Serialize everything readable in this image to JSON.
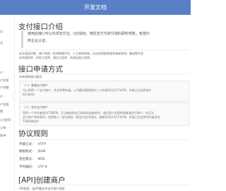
{
  "header": {
    "title": "开发文档"
  },
  "sidebar": {
    "items": [
      {
        "label": "口"
      },
      {
        "label": "式"
      },
      {
        "label": "户"
      },
      {
        "label": "户信息"
      },
      {
        "label": "户余额"
      },
      {
        "label": "户"
      },
      {
        "label": "户信息"
      },
      {
        "label": "费"
      },
      {
        "label": "(小程序)"
      },
      {
        "label": "订单"
      },
      {
        "label": "款单"
      }
    ]
  },
  "main": {
    "section_title": "支付接口介绍",
    "intro_lines": [
      "使用此接口可以实现支付宝、QQ钱包、微信支付与财付通的即时到账，免签约",
      "商企业认证。"
    ],
    "para1": "本文阅读对象：商户系统（在线购物平台、人工收银系统、自动化智能收银系统或其他）集成细节及",
    "para2": "技术架构师、研发工程师、测试工程师、系统运维工程师。",
    "apply_title": "接口申请方式",
    "apply_sub": "共有两种接口模式：",
    "card1": {
      "title": "（一）普通支付商户",
      "line1": "可以获得一个支付商户，完全免费申请。公司随时随地联系人工申请QQ10373458，申请之后会将商户",
      "line2": "KEY给你！"
    },
    "card2": {
      "title": "（二）合作支付商户",
      "line1": "获得一个合作者身份TOKEN，可以集成到自己的网站或者软件，通过接口无限申请普通支付商户，并且当",
      "line2": "支付商户有收款时，所得收入一部分佣金（佣金为合作身份，请联系QQ10373458，申请之后会将合作者身份",
      "line3": "TOKEN给你！"
    },
    "protocol_title": "协议规则",
    "protocol_rows": [
      {
        "key": "传输方式：",
        "value": "HTTP"
      },
      {
        "key": "数据格式：",
        "value": "JSON"
      },
      {
        "key": "签名算法：",
        "value": "MD5"
      },
      {
        "key": "字符编码：",
        "value": "UTF-8"
      }
    ],
    "api_title": "[API]创建商户",
    "api_note": "API权限：该API能合作支付商户调用"
  }
}
